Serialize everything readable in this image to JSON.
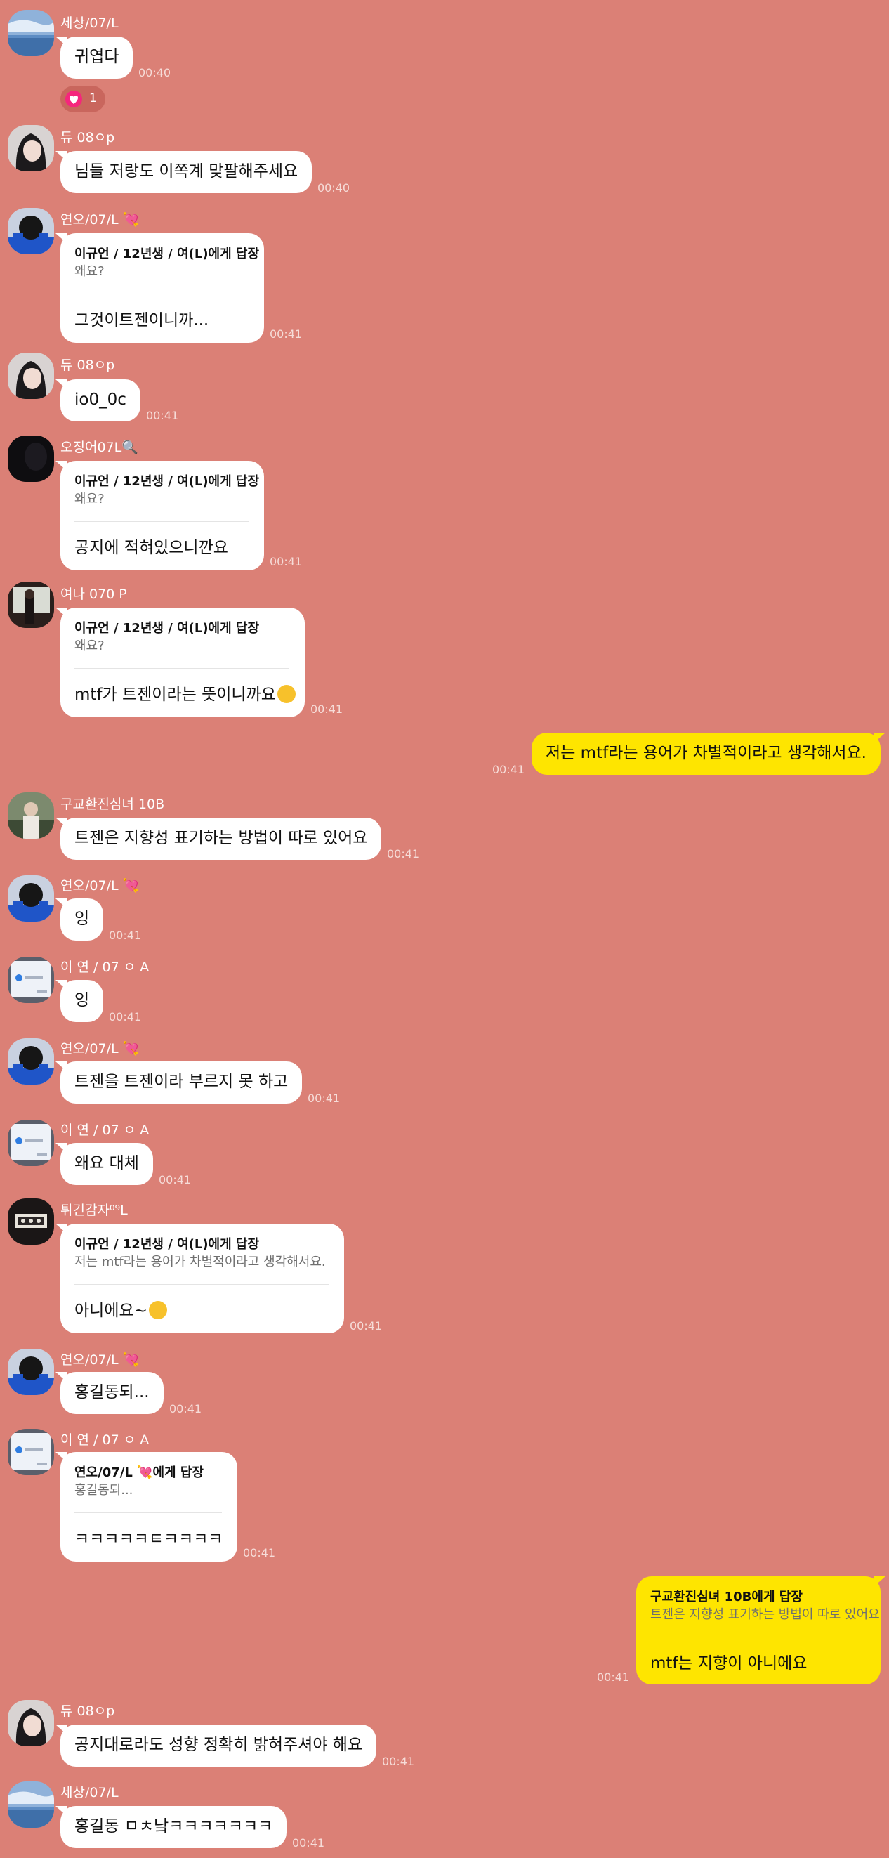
{
  "messages": [
    {
      "sender": "세상/07/L",
      "text": "귀엽다",
      "time": "00:40",
      "reaction_count": "1"
    },
    {
      "sender": "듀 08ㅇp",
      "text": "님들 저랑도 이쪽계 맞팔해주세요",
      "time": "00:40"
    },
    {
      "sender": "연오/07/L 💘",
      "reply_header": "이규언 / 12년생 / 여(L)에게 답장",
      "reply_quote": "왜요?",
      "text": "그것이트젠이니까...",
      "time": "00:41"
    },
    {
      "sender": "듀 08ㅇp",
      "text": "io0_0c",
      "time": "00:41"
    },
    {
      "sender": "오징어07L🔍",
      "reply_header": "이규언 / 12년생 / 여(L)에게 답장",
      "reply_quote": "왜요?",
      "text": "공지에 적혀있으니깐요",
      "time": "00:41"
    },
    {
      "sender": "여나 070 P",
      "reply_header": "이규언 / 12년생 / 여(L)에게 답장",
      "reply_quote": "왜요?",
      "text": "mtf가 트젠이라는 뜻이니까요",
      "time": "00:41"
    },
    {
      "text": "저는 mtf라는 용어가 차별적이라고 생각해서요.",
      "time": "00:41"
    },
    {
      "sender": "구교환진심녀 10B",
      "text": "트젠은 지향성 표기하는 방법이 따로 있어요",
      "time": "00:41"
    },
    {
      "sender": "연오/07/L 💘",
      "text": "잉",
      "time": "00:41"
    },
    {
      "sender": "이 연 / 07 ㅇ A",
      "text": "잉",
      "time": "00:41"
    },
    {
      "sender": "연오/07/L 💘",
      "text": "트젠을 트젠이라 부르지 못 하고",
      "time": "00:41"
    },
    {
      "sender": "이 연 / 07 ㅇ A",
      "text": "왜요 대체",
      "time": "00:41"
    },
    {
      "sender": "튀긴감자⁰⁹L",
      "reply_header": "이규언 / 12년생 / 여(L)에게 답장",
      "reply_quote": "저는 mtf라는 용어가 차별적이라고 생각해서요.",
      "text": "아니에요~",
      "time": "00:41"
    },
    {
      "sender": "연오/07/L 💘",
      "text": "홍길동되...",
      "time": "00:41"
    },
    {
      "sender": "이 연 / 07 ㅇ A",
      "reply_header": "연오/07/L 💘에게 답장",
      "reply_quote": "홍길동되...",
      "text": "ㅋㅋㅋㅋㅋㅌㅋㅋㅋㅋ",
      "time": "00:41"
    },
    {
      "reply_header": "구교환진심녀 10B에게 답장",
      "reply_quote": "트젠은 지향성 표기하는 방법이 따로 있어요",
      "text": "mtf는 지향이 아니에요",
      "time": "00:41"
    },
    {
      "sender": "듀 08ㅇp",
      "text": "공지대로라도 성향 정확히 밝혀주셔야 해요",
      "time": "00:41"
    },
    {
      "sender": "세상/07/L",
      "text": "홍길동 ㅁㅊ낰ㅋㅋㅋㅋㅋㅋㅋ",
      "time": "00:41"
    }
  ],
  "icons": {
    "heart": "heart-icon",
    "emoji_smile": "smiling-face-icon",
    "emoji_hug": "hugging-face-icon"
  },
  "colors": {
    "chat_background": "#db8076",
    "incoming_bubble": "#ffffff",
    "outgoing_bubble": "#fee500",
    "reaction_heart": "#f5267d"
  }
}
